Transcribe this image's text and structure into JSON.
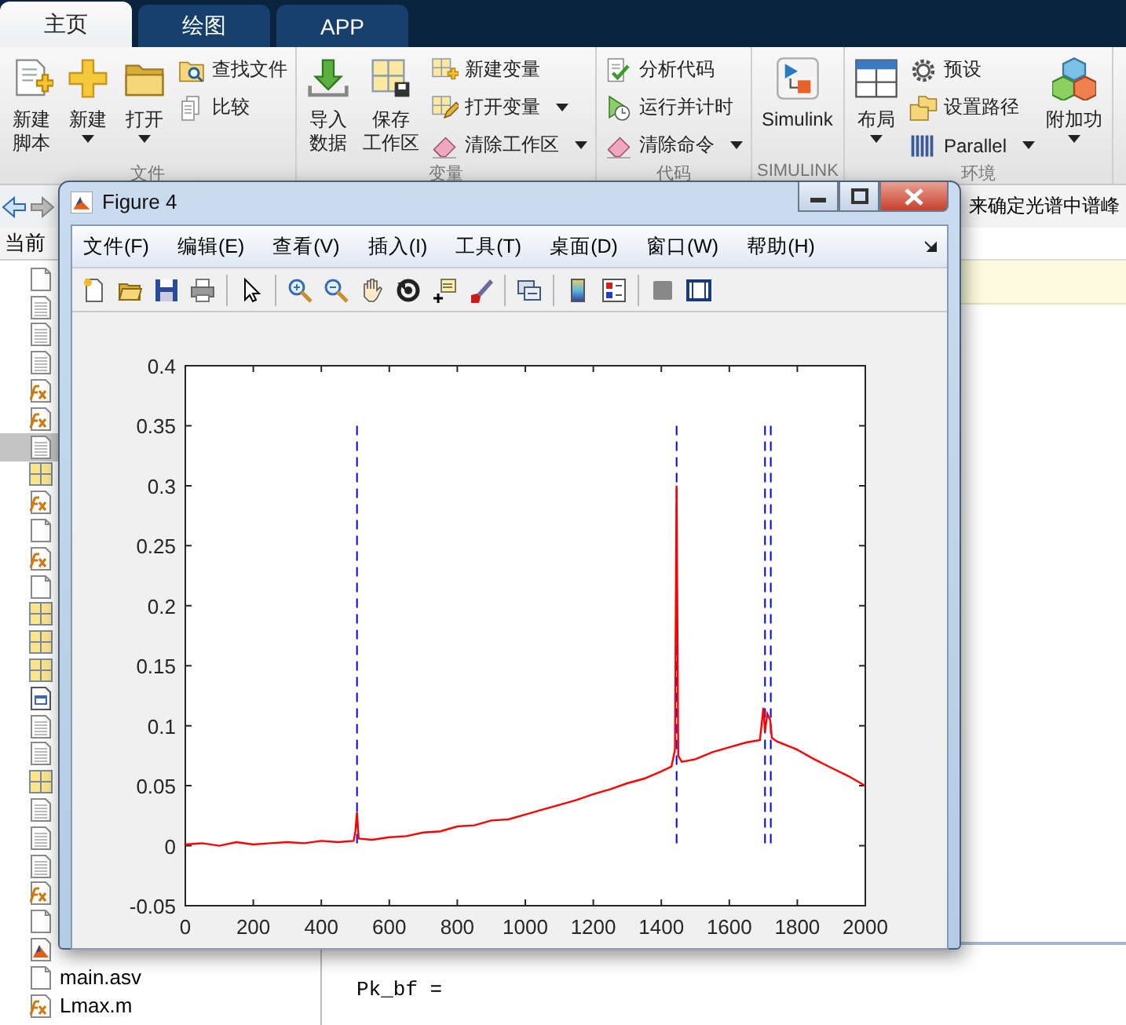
{
  "tabs": [
    {
      "label": "主页",
      "selected": true
    },
    {
      "label": "绘图",
      "selected": false
    },
    {
      "label": "APP",
      "selected": false
    }
  ],
  "ribbon": {
    "groups": [
      {
        "label": "文件",
        "items": [
          {
            "kind": "large",
            "lines": [
              "新建",
              "脚本"
            ],
            "dropdown": false
          },
          {
            "kind": "large",
            "lines": [
              "新建"
            ],
            "dropdown": true
          },
          {
            "kind": "large",
            "lines": [
              "打开"
            ],
            "dropdown": true
          },
          {
            "kind": "stack",
            "items": [
              {
                "label": "查找文件",
                "dropdown": false
              },
              {
                "label": "比较",
                "dropdown": false
              }
            ]
          }
        ]
      },
      {
        "label": "变量",
        "items": [
          {
            "kind": "large",
            "lines": [
              "导入",
              "数据"
            ],
            "dropdown": false
          },
          {
            "kind": "large",
            "lines": [
              "保存",
              "工作区"
            ],
            "dropdown": false
          },
          {
            "kind": "stack",
            "items": [
              {
                "label": "新建变量",
                "dropdown": false
              },
              {
                "label": "打开变量",
                "dropdown": true
              },
              {
                "label": "清除工作区",
                "dropdown": true
              }
            ]
          }
        ]
      },
      {
        "label": "代码",
        "items": [
          {
            "kind": "stack",
            "items": [
              {
                "label": "分析代码",
                "dropdown": false
              },
              {
                "label": "运行并计时",
                "dropdown": false
              },
              {
                "label": "清除命令",
                "dropdown": true
              }
            ]
          }
        ]
      },
      {
        "label": "SIMULINK",
        "items": [
          {
            "kind": "large",
            "lines": [
              "Simulink"
            ],
            "dropdown": false
          }
        ]
      },
      {
        "label": "环境",
        "items": [
          {
            "kind": "large",
            "lines": [
              "布局"
            ],
            "dropdown": true
          },
          {
            "kind": "stack",
            "items": [
              {
                "label": "预设",
                "dropdown": false
              },
              {
                "label": "设置路径",
                "dropdown": false
              },
              {
                "label": "Parallel",
                "dropdown": true
              }
            ]
          },
          {
            "kind": "large",
            "lines": [
              "附加功"
            ],
            "dropdown": true
          }
        ]
      }
    ]
  },
  "current_folder": {
    "header": "当前",
    "files": [
      {
        "kind": "blank",
        "selected": false
      },
      {
        "kind": "script",
        "selected": false
      },
      {
        "kind": "script",
        "selected": false
      },
      {
        "kind": "script",
        "selected": false
      },
      {
        "kind": "function",
        "selected": false
      },
      {
        "kind": "function",
        "selected": false
      },
      {
        "kind": "script",
        "selected": true
      },
      {
        "kind": "grid",
        "selected": false
      },
      {
        "kind": "function",
        "selected": false
      },
      {
        "kind": "blank",
        "selected": false
      },
      {
        "kind": "function",
        "selected": false
      },
      {
        "kind": "blank",
        "selected": false
      },
      {
        "kind": "grid",
        "selected": false
      },
      {
        "kind": "grid",
        "selected": false
      },
      {
        "kind": "grid",
        "selected": false
      },
      {
        "kind": "fig",
        "selected": false
      },
      {
        "kind": "script",
        "selected": false
      },
      {
        "kind": "script",
        "selected": false
      },
      {
        "kind": "grid",
        "selected": false
      },
      {
        "kind": "script",
        "selected": false
      },
      {
        "kind": "script",
        "selected": false
      },
      {
        "kind": "script",
        "selected": false
      },
      {
        "kind": "function",
        "selected": false
      },
      {
        "kind": "blank",
        "selected": false
      },
      {
        "kind": "mfig",
        "selected": false
      },
      {
        "kind": "blank",
        "name": "main.asv",
        "selected": false
      },
      {
        "kind": "function",
        "name": "Lmax.m",
        "selected": false
      }
    ]
  },
  "editor": {
    "title": "来确定光谱中谱峰"
  },
  "command_window": {
    "text": "Pk_bf ="
  },
  "figure": {
    "title": "Figure 4",
    "menu": [
      "文件(F)",
      "编辑(E)",
      "查看(V)",
      "插入(I)",
      "工具(T)",
      "桌面(D)",
      "窗口(W)",
      "帮助(H)"
    ],
    "chart_data": {
      "type": "line",
      "xlim": [
        0,
        2000
      ],
      "ylim": [
        -0.05,
        0.4
      ],
      "xticks": [
        0,
        200,
        400,
        600,
        800,
        1000,
        1200,
        1400,
        1600,
        1800,
        2000
      ],
      "yticks": [
        -0.05,
        0,
        0.05,
        0.1,
        0.15,
        0.2,
        0.25,
        0.3,
        0.35,
        0.4
      ],
      "x": [
        0,
        50,
        100,
        150,
        200,
        250,
        300,
        350,
        400,
        450,
        495,
        500,
        505,
        510,
        550,
        600,
        650,
        700,
        750,
        800,
        850,
        900,
        950,
        1000,
        1050,
        1100,
        1150,
        1200,
        1250,
        1300,
        1350,
        1400,
        1430,
        1440,
        1445,
        1450,
        1460,
        1500,
        1550,
        1600,
        1650,
        1690,
        1700,
        1705,
        1712,
        1720,
        1725,
        1740,
        1800,
        1850,
        1900,
        1950,
        2000
      ],
      "series": [
        {
          "color": "#ff0000",
          "values": [
            0.001,
            0.002,
            0.0,
            0.003,
            0.001,
            0.002,
            0.003,
            0.002,
            0.004,
            0.003,
            0.004,
            0.012,
            0.028,
            0.006,
            0.005,
            0.007,
            0.008,
            0.011,
            0.012,
            0.016,
            0.017,
            0.021,
            0.022,
            0.026,
            0.03,
            0.034,
            0.038,
            0.043,
            0.047,
            0.052,
            0.056,
            0.062,
            0.066,
            0.08,
            0.3,
            0.075,
            0.07,
            0.072,
            0.078,
            0.082,
            0.086,
            0.088,
            0.115,
            0.095,
            0.11,
            0.105,
            0.09,
            0.087,
            0.08,
            0.072,
            0.065,
            0.058,
            0.05
          ]
        }
      ],
      "ref_lines": [
        {
          "axis": "x",
          "value": 505
        },
        {
          "axis": "x",
          "value": 1445
        },
        {
          "axis": "x",
          "value": 1705
        },
        {
          "axis": "x",
          "value": 1722
        }
      ]
    }
  }
}
